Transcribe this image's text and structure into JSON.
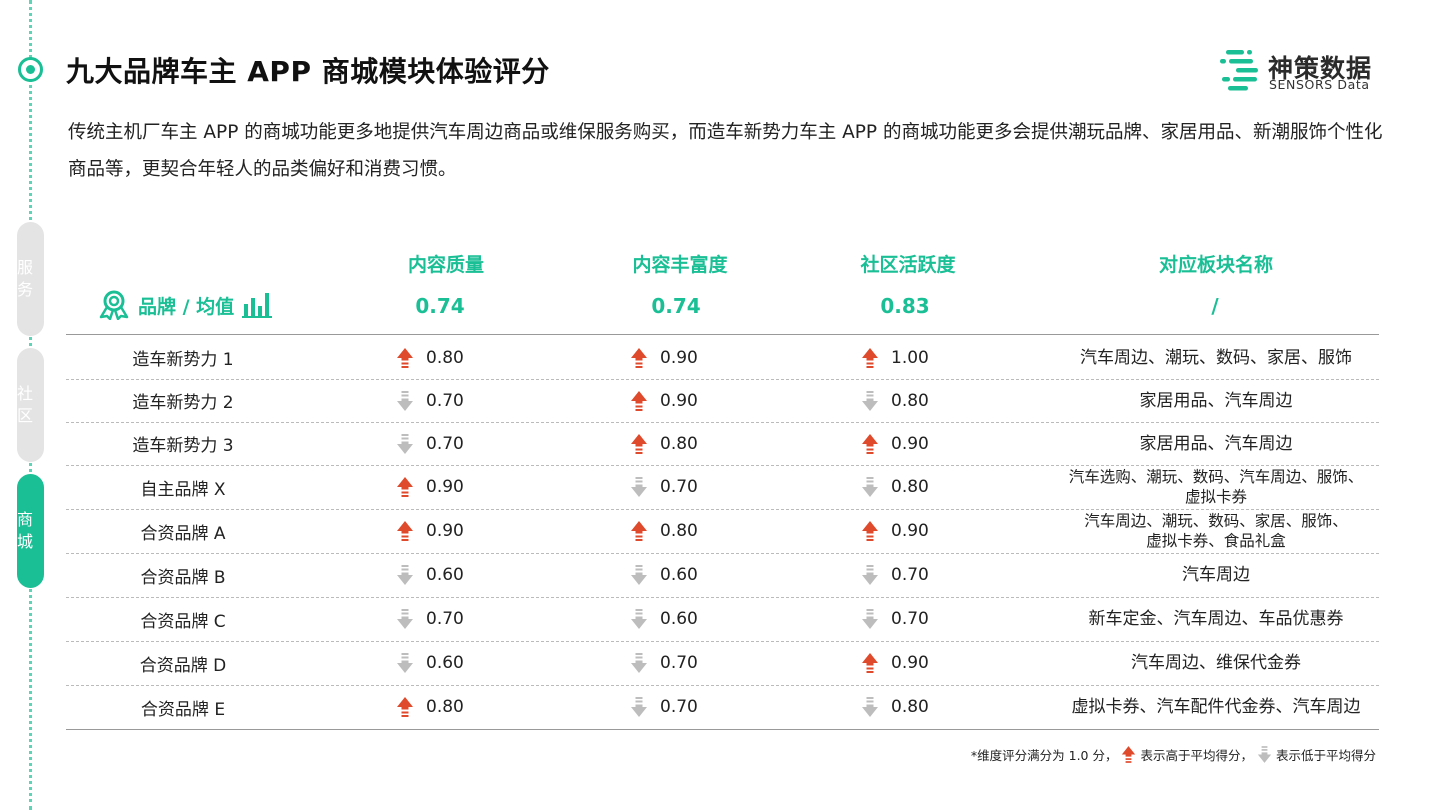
{
  "title": "九大品牌车主 APP 商城模块体验评分",
  "description": "传统主机厂车主 APP 的商城功能更多地提供汽车周边商品或维保服务购买，而造车新势力车主 APP 的商城功能更多会提供潮玩品牌、家居用品、新潮服饰个性化商品等，更契合年轻人的品类偏好和消费习惯。",
  "logo": {
    "cn": "神策数据",
    "en": "SENSORS Data"
  },
  "rail": {
    "tabs": [
      "服务",
      "社区",
      "商城"
    ],
    "active": "商城"
  },
  "colors": {
    "accent": "#1bbf95",
    "up": "#e04a2c",
    "down": "#bdbdbd"
  },
  "table": {
    "brand_header": "品牌 / 均值",
    "brand_header_icons": [
      "award-ribbon-icon",
      "bar-chart-icon"
    ],
    "columns": [
      {
        "name": "内容质量",
        "avg": "0.74"
      },
      {
        "name": "内容丰富度",
        "avg": "0.74"
      },
      {
        "name": "社区活跃度",
        "avg": "0.83"
      },
      {
        "name": "对应板块名称",
        "avg": "/"
      }
    ],
    "rows": [
      {
        "brand": "造车新势力 1",
        "scores": [
          {
            "v": "0.80",
            "dir": "up"
          },
          {
            "v": "0.90",
            "dir": "up"
          },
          {
            "v": "1.00",
            "dir": "up"
          }
        ],
        "sections": "汽车周边、潮玩、数码、家居、服饰"
      },
      {
        "brand": "造车新势力 2",
        "scores": [
          {
            "v": "0.70",
            "dir": "down"
          },
          {
            "v": "0.90",
            "dir": "up"
          },
          {
            "v": "0.80",
            "dir": "down"
          }
        ],
        "sections": "家居用品、汽车周边"
      },
      {
        "brand": "造车新势力 3",
        "scores": [
          {
            "v": "0.70",
            "dir": "down"
          },
          {
            "v": "0.80",
            "dir": "up"
          },
          {
            "v": "0.90",
            "dir": "up"
          }
        ],
        "sections": "家居用品、汽车周边"
      },
      {
        "brand": "自主品牌 X",
        "scores": [
          {
            "v": "0.90",
            "dir": "up"
          },
          {
            "v": "0.70",
            "dir": "down"
          },
          {
            "v": "0.80",
            "dir": "down"
          }
        ],
        "sections": [
          "汽车选购、潮玩、数码、汽车周边、服饰、",
          "虚拟卡券"
        ]
      },
      {
        "brand": "合资品牌 A",
        "scores": [
          {
            "v": "0.90",
            "dir": "up"
          },
          {
            "v": "0.80",
            "dir": "up"
          },
          {
            "v": "0.90",
            "dir": "up"
          }
        ],
        "sections": [
          "汽车周边、潮玩、数码、家居、服饰、",
          "虚拟卡券、食品礼盒"
        ]
      },
      {
        "brand": "合资品牌 B",
        "scores": [
          {
            "v": "0.60",
            "dir": "down"
          },
          {
            "v": "0.60",
            "dir": "down"
          },
          {
            "v": "0.70",
            "dir": "down"
          }
        ],
        "sections": "汽车周边"
      },
      {
        "brand": "合资品牌 C",
        "scores": [
          {
            "v": "0.70",
            "dir": "down"
          },
          {
            "v": "0.60",
            "dir": "down"
          },
          {
            "v": "0.70",
            "dir": "down"
          }
        ],
        "sections": "新车定金、汽车周边、车品优惠券"
      },
      {
        "brand": "合资品牌 D",
        "scores": [
          {
            "v": "0.60",
            "dir": "down"
          },
          {
            "v": "0.70",
            "dir": "down"
          },
          {
            "v": "0.90",
            "dir": "up"
          }
        ],
        "sections": "汽车周边、维保代金券"
      },
      {
        "brand": "合资品牌 E",
        "scores": [
          {
            "v": "0.80",
            "dir": "up"
          },
          {
            "v": "0.70",
            "dir": "down"
          },
          {
            "v": "0.80",
            "dir": "down"
          }
        ],
        "sections": "虚拟卡券、汽车配件代金券、汽车周边"
      }
    ]
  },
  "footnote": {
    "prefix": "*维度评分满分为 1.0 分，",
    "up_text": "表示高于平均得分，",
    "down_text": "表示低于平均得分"
  }
}
